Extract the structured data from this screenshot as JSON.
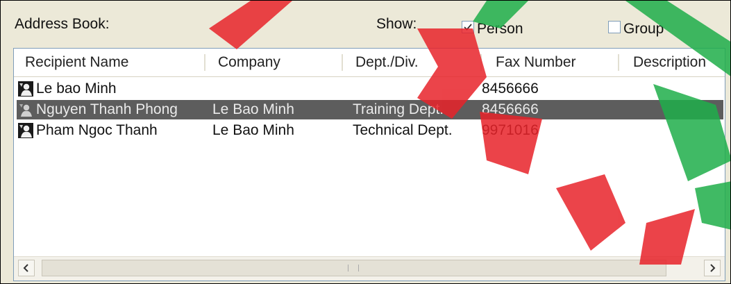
{
  "header": {
    "address_book_label": "Address Book:",
    "show_label": "Show:",
    "person_label": "Person",
    "person_checked": true,
    "group_label": "Group",
    "group_checked": false
  },
  "columns": [
    "Recipient Name",
    "Company",
    "Dept./Div.",
    "Fax Number",
    "Description"
  ],
  "rows": [
    {
      "name": "Le bao Minh",
      "company": "",
      "dept": "",
      "fax": "8456666",
      "description": "",
      "selected": false
    },
    {
      "name": "Nguyen Thanh Phong",
      "company": "Le Bao Minh",
      "dept": "Training Dept.",
      "fax": "8456666",
      "description": "",
      "selected": true
    },
    {
      "name": "Pham Ngoc Thanh",
      "company": "Le Bao Minh",
      "dept": "Technical Dept.",
      "fax": "9971016",
      "description": "",
      "selected": false
    }
  ],
  "icons": {
    "row_icon": "person-icon",
    "scroll_left": "chevron-left-icon",
    "scroll_right": "chevron-right-icon"
  },
  "colors": {
    "selection": "#5d5d5d",
    "watermark_red": "#e8232a",
    "watermark_green": "#1fae4a"
  }
}
